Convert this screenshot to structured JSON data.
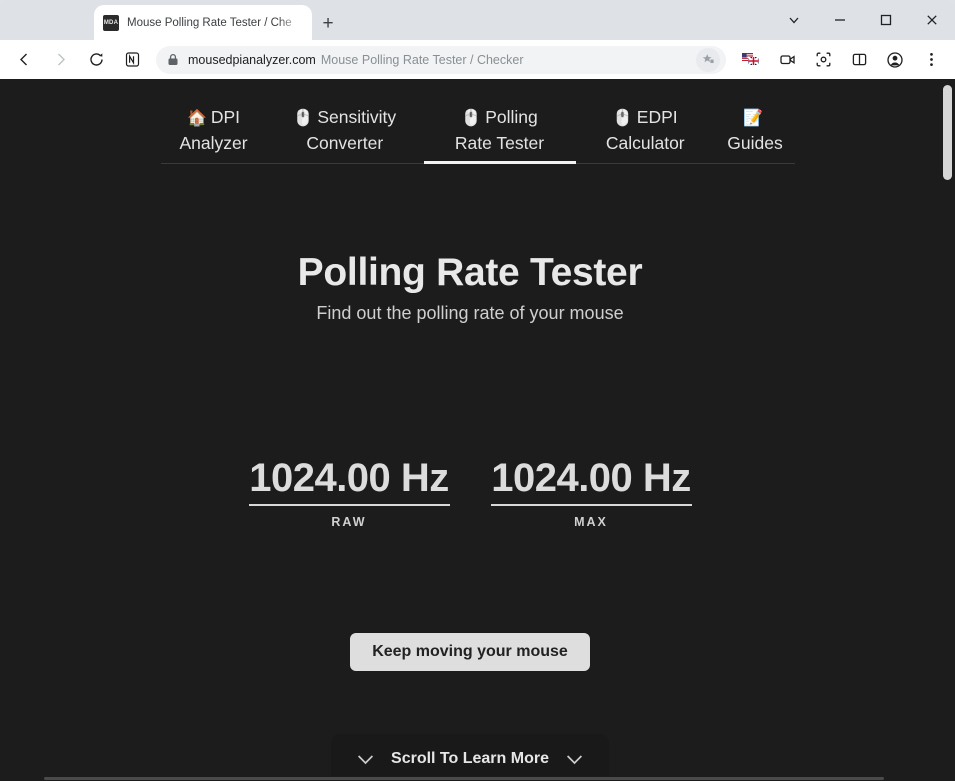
{
  "window": {
    "controls": [
      {
        "name": "tab-search",
        "icon": "chevron-down-icon"
      },
      {
        "name": "minimize",
        "icon": "minimize-icon"
      },
      {
        "name": "maximize",
        "icon": "maximize-icon"
      },
      {
        "name": "close",
        "icon": "close-icon"
      }
    ]
  },
  "tab": {
    "title": "Mouse Polling Rate Tester / Che",
    "favicon_text": "MDA",
    "newtab_label": "+"
  },
  "toolbar": {
    "back_icon": "back-arrow-icon",
    "forward_icon": "forward-arrow-icon",
    "reload_icon": "reload-icon",
    "extension_icon": "nord-n-icon",
    "lock_icon": "lock-icon",
    "url_domain": "mousedpianalyzer.com",
    "url_title": "Mouse Polling Rate Tester / Checker",
    "star_icon": "bookmark-star-icon",
    "right_icons": [
      {
        "name": "language-flag-icon"
      },
      {
        "name": "video-camera-icon"
      },
      {
        "name": "screenshot-capture-icon"
      },
      {
        "name": "split-screen-icon"
      },
      {
        "name": "profile-avatar-icon"
      },
      {
        "name": "three-dot-menu-icon"
      }
    ]
  },
  "page": {
    "nav": [
      {
        "emoji": "🏠",
        "line1": "DPI",
        "line2": "Analyzer",
        "active": false
      },
      {
        "emoji": "🖱️",
        "line1": "Sensitivity",
        "line2": "Converter",
        "active": false
      },
      {
        "emoji": "🖱️",
        "line1": "Polling",
        "line2": "Rate Tester",
        "active": true
      },
      {
        "emoji": "🖱️",
        "line1": "EDPI",
        "line2": "Calculator",
        "active": false
      },
      {
        "emoji": "📝",
        "line1": "",
        "line2": "Guides",
        "active": false
      }
    ],
    "title": "Polling Rate Tester",
    "subtitle": "Find out the polling rate of your mouse",
    "readouts": [
      {
        "value": "1024.00 Hz",
        "label": "RAW"
      },
      {
        "value": "1024.00 Hz",
        "label": "MAX"
      }
    ],
    "hint_button": "Keep moving your mouse",
    "scroll_cta": "Scroll To Learn More"
  },
  "colors": {
    "page_bg": "#1c1c1c",
    "accent_text": "#e8e8e8",
    "button_bg": "#dedede",
    "card_bg": "#191919"
  }
}
